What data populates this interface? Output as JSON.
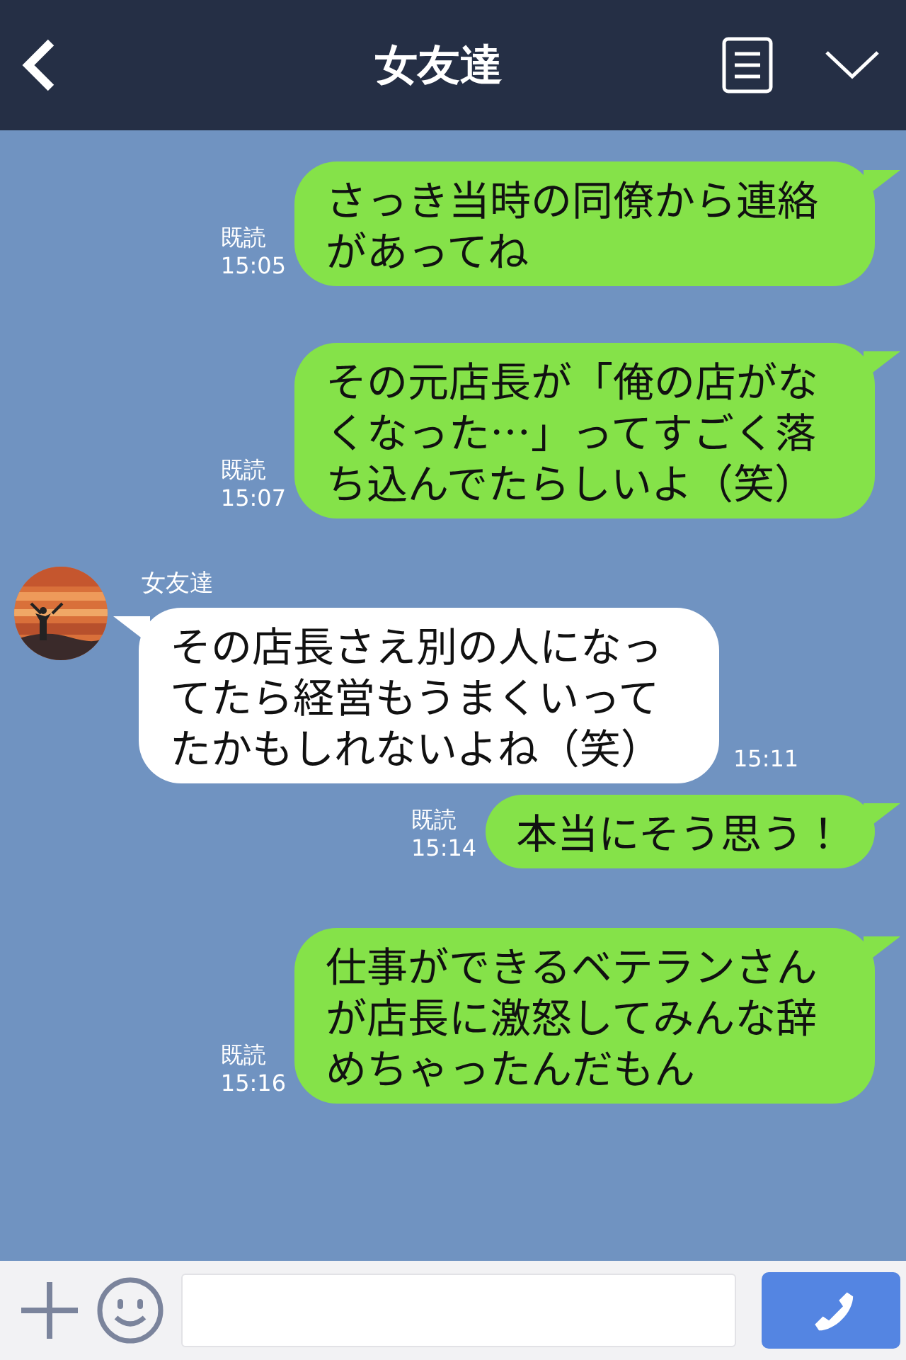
{
  "header": {
    "title": "女友達"
  },
  "messages": [
    {
      "kind": "sent",
      "text": "さっき当時の同僚から連絡があってね",
      "read": "既読",
      "time": "15:05"
    },
    {
      "kind": "sent",
      "text": "その元店長が「俺の店がなくなった…」ってすごく落ち込んでたらしいよ（笑）",
      "read": "既読",
      "time": "15:07"
    },
    {
      "kind": "received",
      "sender": "女友達",
      "text": "その店長さえ別の人になってたら経営もうまくいってたかもしれないよね（笑）",
      "time": "15:11"
    },
    {
      "kind": "sent",
      "text": "本当にそう思う！",
      "read": "既読",
      "time": "15:14"
    },
    {
      "kind": "sent",
      "text": "仕事ができるベテランさんが店長に激怒してみんな辞めちゃったんだもん",
      "read": "既読",
      "time": "15:16"
    }
  ]
}
